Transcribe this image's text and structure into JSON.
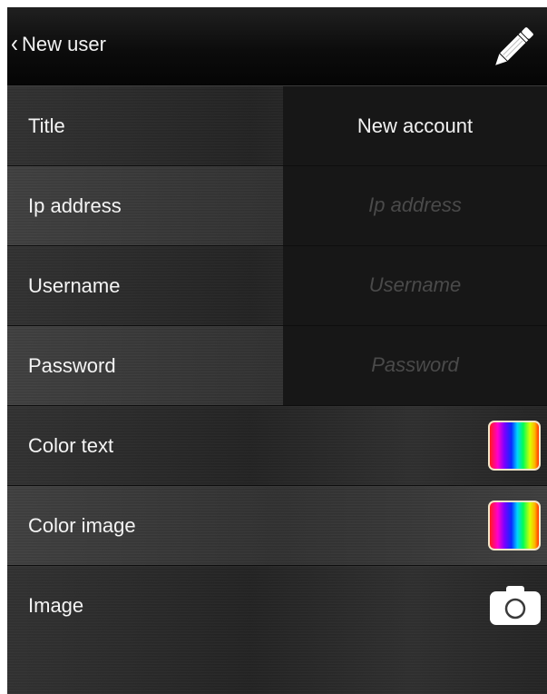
{
  "navbar": {
    "back_label": "New user",
    "back_icon": "chevron-left-icon",
    "edit_icon": "pencil-icon"
  },
  "rows": [
    {
      "label": "Title",
      "value": "New account"
    },
    {
      "label": "Ip address",
      "placeholder": "Ip address",
      "value": ""
    },
    {
      "label": "Username",
      "placeholder": "Username",
      "value": ""
    },
    {
      "label": "Password",
      "placeholder": "Password",
      "value": ""
    },
    {
      "label": "Color text",
      "control": "color-swatch"
    },
    {
      "label": "Color image",
      "control": "color-swatch"
    },
    {
      "label": "Image",
      "control": "camera-icon"
    }
  ],
  "colors": {
    "background": "#1b1b1b",
    "text": "#f4f4f4",
    "placeholder": "#4a4a4a",
    "swatch_border": "#f3e7c9"
  }
}
